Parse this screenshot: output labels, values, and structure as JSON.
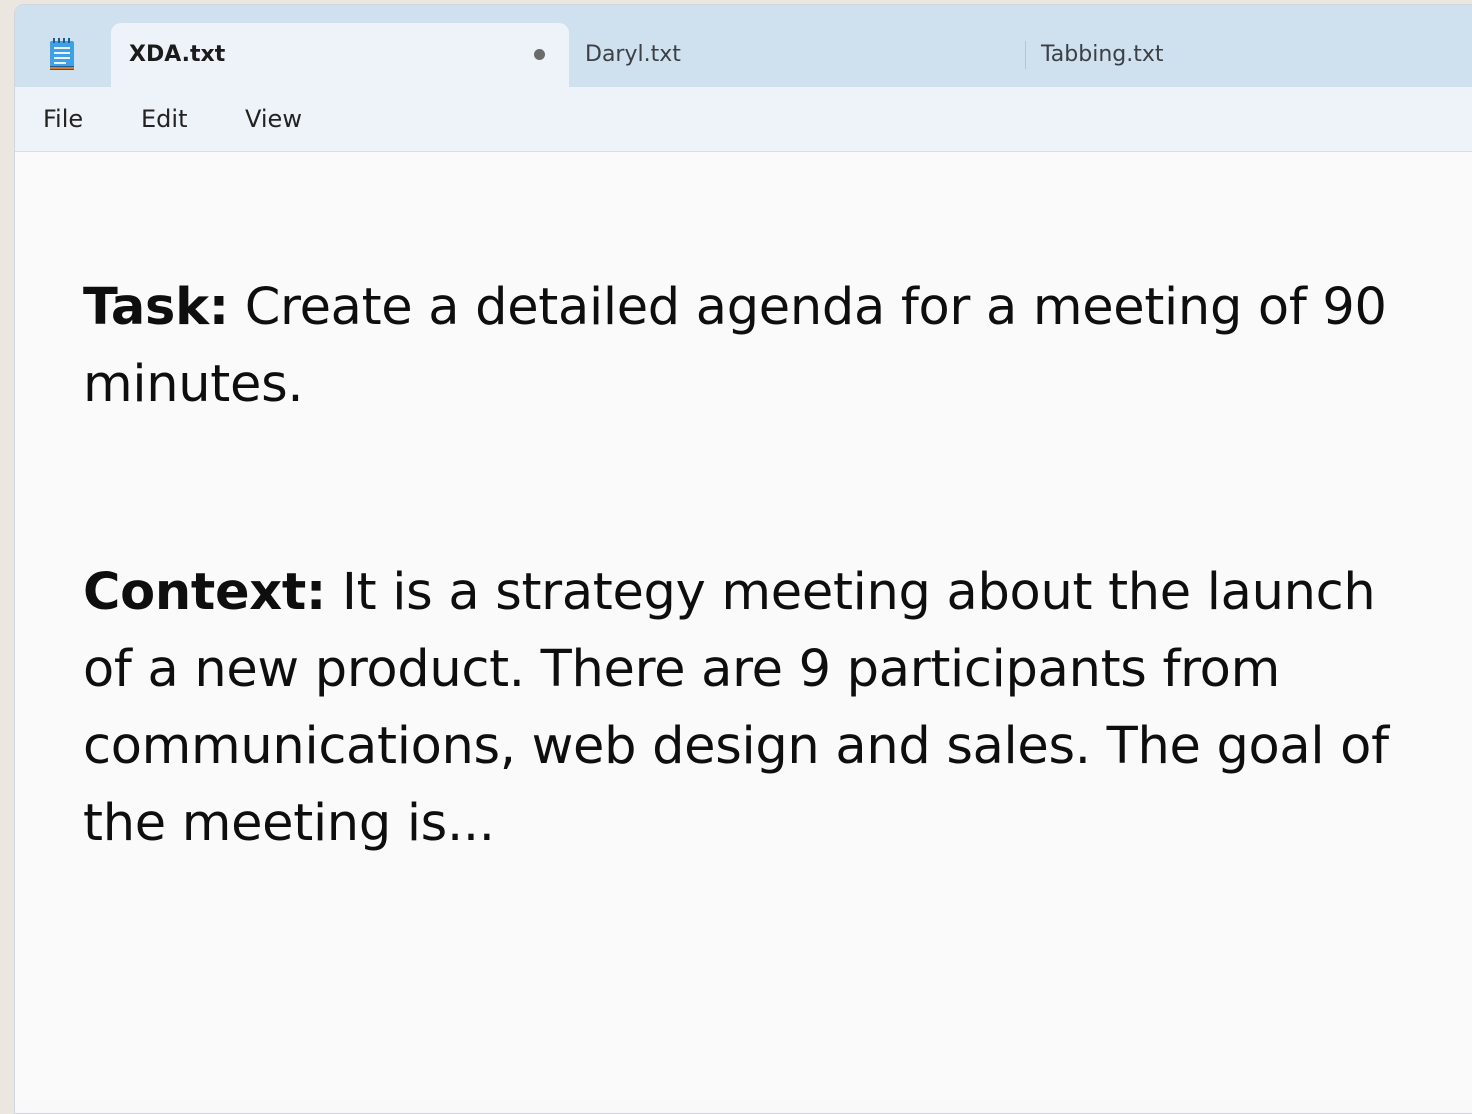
{
  "tabs": [
    {
      "label": "XDA.txt",
      "active": true,
      "unsaved": true
    },
    {
      "label": "Daryl.txt",
      "active": false
    },
    {
      "label": "Tabbing.txt",
      "active": false
    }
  ],
  "menu": {
    "file": "File",
    "edit": "Edit",
    "view": "View"
  },
  "document": {
    "task_label": "Task:",
    "task_text": " Create a detailed agenda for a meeting of 90 minutes.",
    "context_label": "Context:",
    "context_text": " It is a strategy meeting about the launch of a new product. There are 9 participants from communications, web design and sales. The goal of the meeting is..."
  },
  "colors": {
    "titlebar": "#cfe0ef",
    "active_tab": "#eef3f9",
    "editor_bg": "#fafafa",
    "icon_accent": "#2b8fd6"
  },
  "icons": {
    "app": "notepad-icon"
  }
}
